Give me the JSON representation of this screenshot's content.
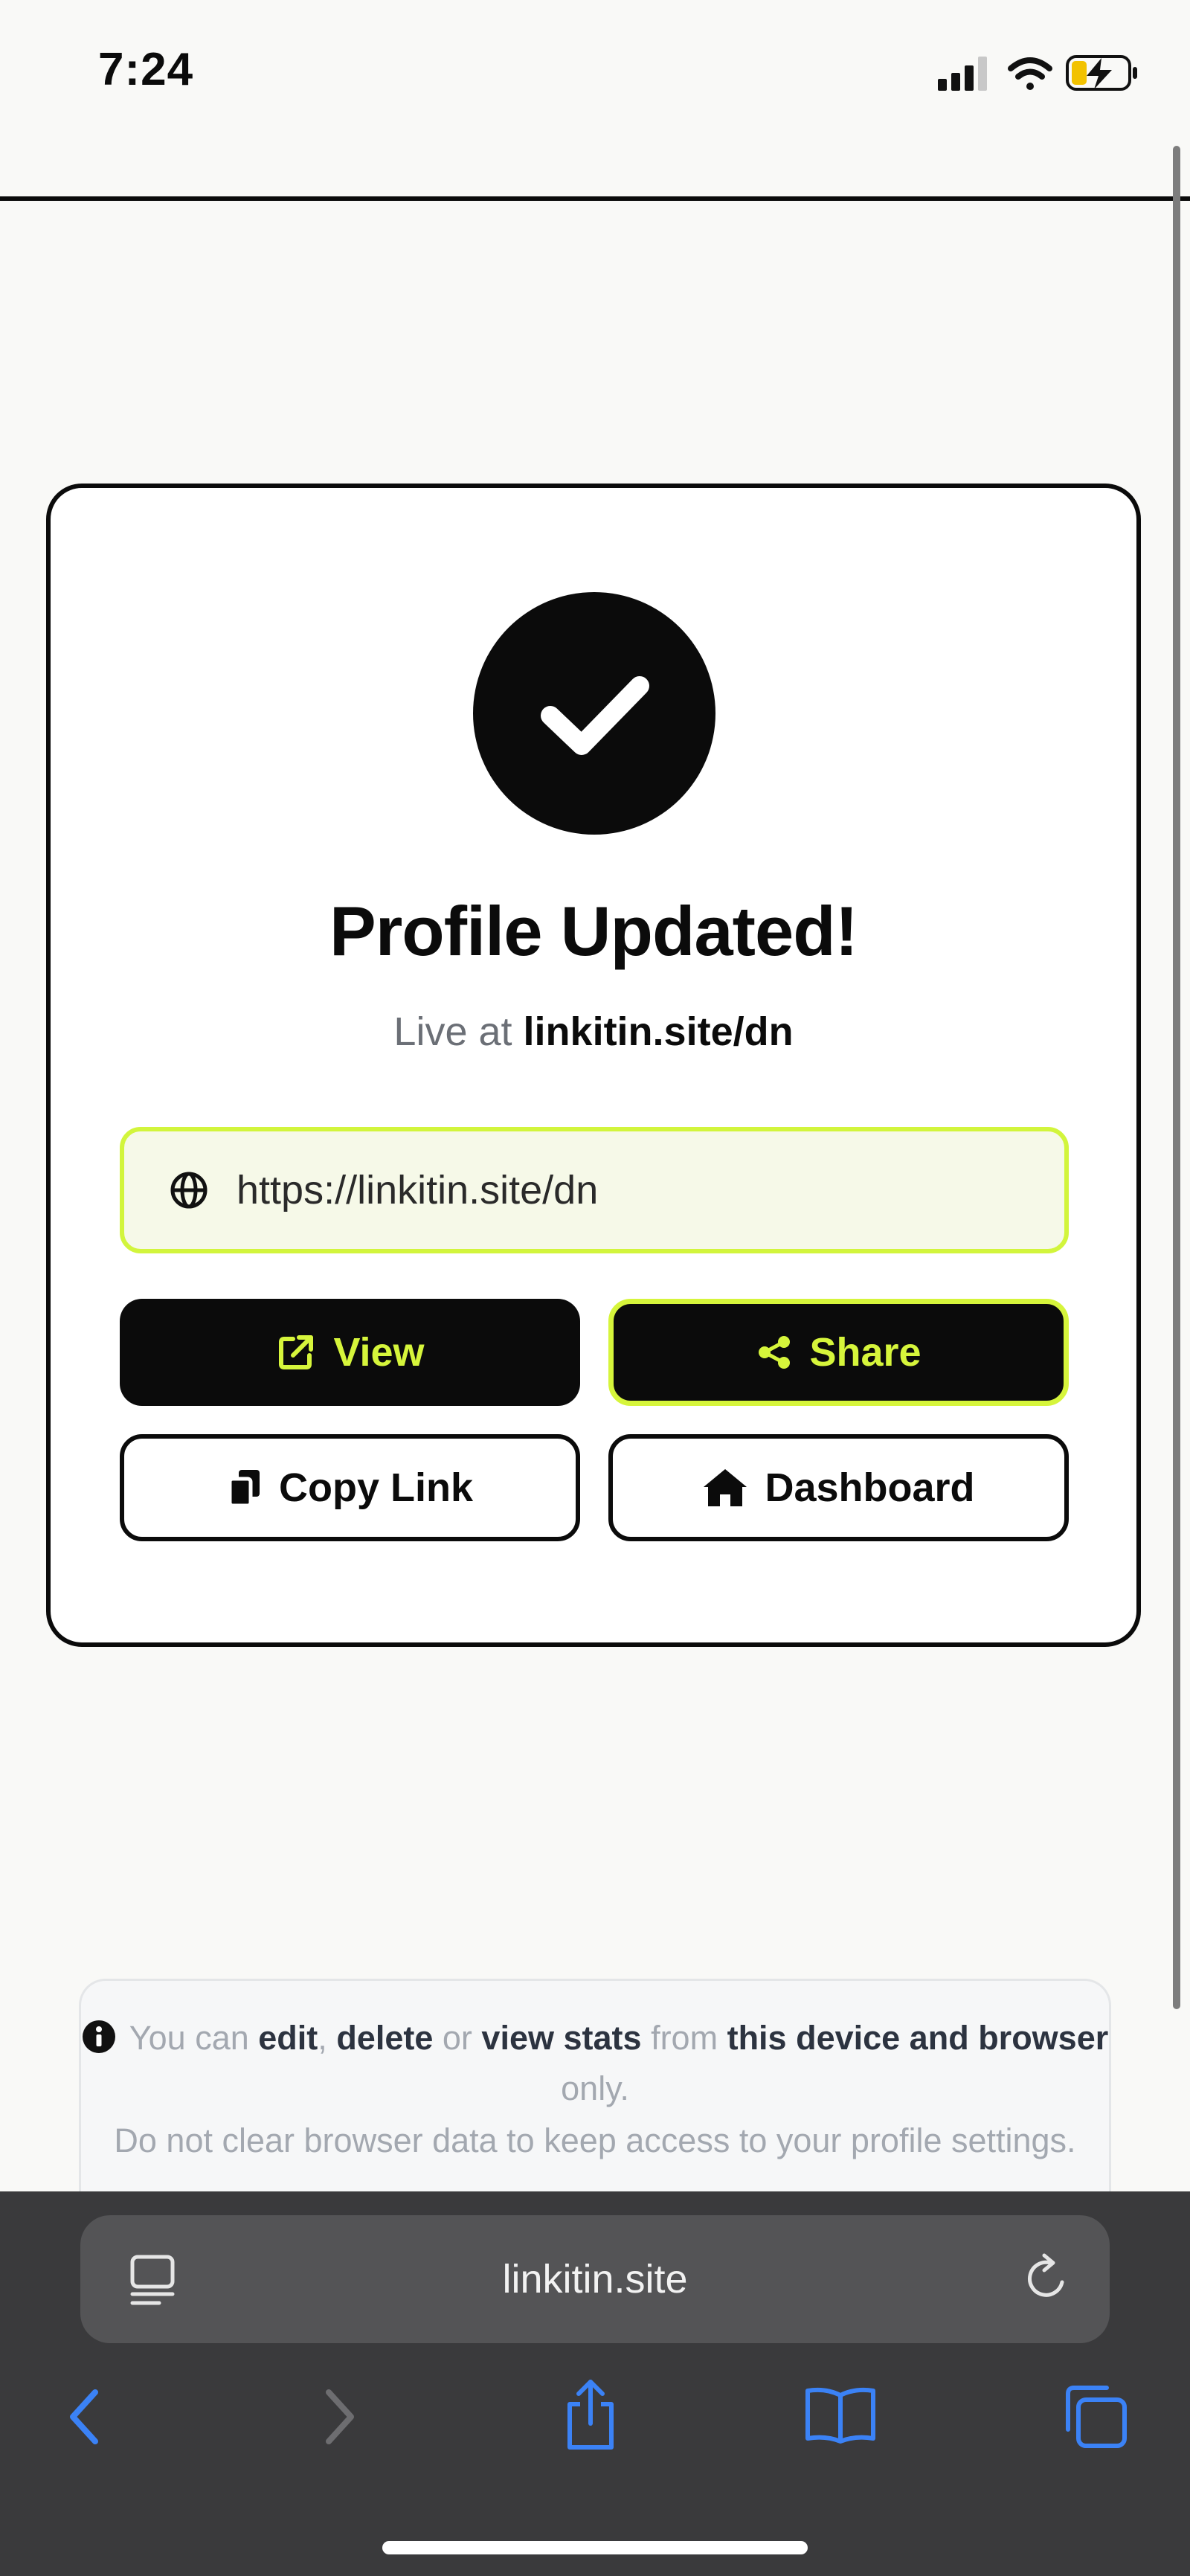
{
  "status_bar": {
    "time": "7:24"
  },
  "card": {
    "title": "Profile Updated!",
    "live_prefix": "Live at",
    "live_link": "linkitin.site/dn",
    "url_value": "https://linkitin.site/dn",
    "buttons": {
      "view": "View",
      "share": "Share",
      "copy_link": "Copy Link",
      "dashboard": "Dashboard"
    }
  },
  "notice": {
    "t1": "You can",
    "edit": "edit",
    "comma": ",",
    "delete": "delete",
    "or": "or",
    "view_stats": "view stats",
    "from": "from",
    "device": "this device and browser",
    "only": "only.",
    "line2": "Do not clear browser data to keep access to your profile settings."
  },
  "browser": {
    "address": "linkitin.site"
  },
  "colors": {
    "accent": "#d6f53b",
    "dark": "#0b0b0b",
    "chrome": "#3a3a3c",
    "ios_blue": "#3b82f6"
  },
  "icons": [
    "signal-icon",
    "wifi-icon",
    "battery-charging-icon",
    "check-icon",
    "globe-icon",
    "external-link-icon",
    "share-nodes-icon",
    "copy-icon",
    "home-icon",
    "info-icon",
    "reader-icon",
    "reload-icon",
    "back-icon",
    "forward-icon",
    "share-icon",
    "bookmarks-icon",
    "tabs-icon"
  ]
}
